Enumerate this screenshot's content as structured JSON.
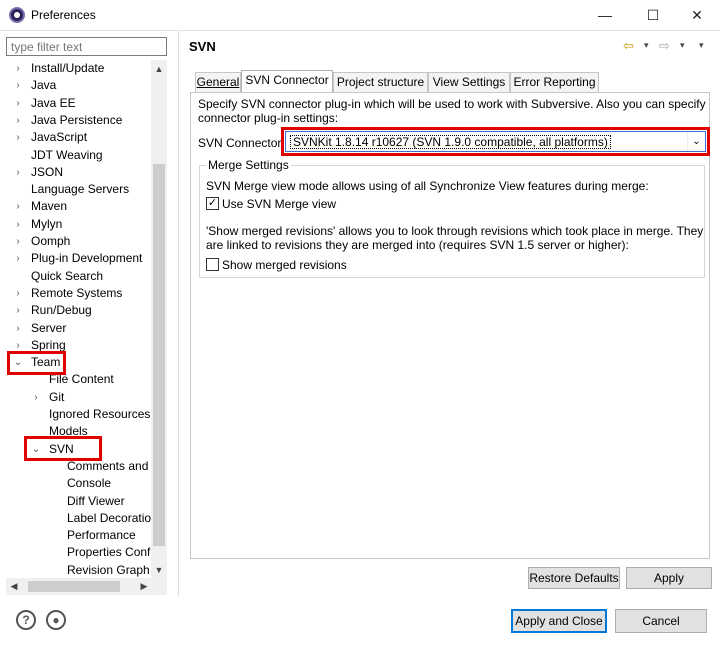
{
  "window": {
    "title": "Preferences",
    "minimize": "—",
    "maximize": "☐",
    "close": "✕"
  },
  "filter": {
    "placeholder": "type filter text"
  },
  "tree": {
    "items": [
      {
        "label": "Install/Update",
        "arrow": "›"
      },
      {
        "label": "Java",
        "arrow": "›"
      },
      {
        "label": "Java EE",
        "arrow": "›"
      },
      {
        "label": "Java Persistence",
        "arrow": "›"
      },
      {
        "label": "JavaScript",
        "arrow": "›"
      },
      {
        "label": "JDT Weaving",
        "arrow": ""
      },
      {
        "label": "JSON",
        "arrow": "›"
      },
      {
        "label": "Language Servers",
        "arrow": ""
      },
      {
        "label": "Maven",
        "arrow": "›"
      },
      {
        "label": "Mylyn",
        "arrow": "›"
      },
      {
        "label": "Oomph",
        "arrow": "›"
      },
      {
        "label": "Plug-in Development",
        "arrow": "›"
      },
      {
        "label": "Quick Search",
        "arrow": ""
      },
      {
        "label": "Remote Systems",
        "arrow": "›"
      },
      {
        "label": "Run/Debug",
        "arrow": "›"
      },
      {
        "label": "Server",
        "arrow": "›"
      },
      {
        "label": "Spring",
        "arrow": "›"
      },
      {
        "label": "Team",
        "arrow": "⌄"
      },
      {
        "label": "File Content",
        "arrow": ""
      },
      {
        "label": "Git",
        "arrow": "›"
      },
      {
        "label": "Ignored Resources",
        "arrow": ""
      },
      {
        "label": "Models",
        "arrow": ""
      },
      {
        "label": "SVN",
        "arrow": "⌄"
      },
      {
        "label": "Comments and",
        "arrow": ""
      },
      {
        "label": "Console",
        "arrow": ""
      },
      {
        "label": "Diff Viewer",
        "arrow": ""
      },
      {
        "label": "Label Decoration",
        "arrow": ""
      },
      {
        "label": "Performance",
        "arrow": ""
      },
      {
        "label": "Properties Confi",
        "arrow": ""
      },
      {
        "label": "Revision Graph",
        "arrow": ""
      }
    ]
  },
  "page": {
    "title": "SVN",
    "tabs": [
      "General",
      "SVN Connector",
      "Project structure",
      "View Settings",
      "Error Reporting"
    ],
    "description_line1": "Specify SVN connector plug-in which will be used to work with Subversive. Also you can specify",
    "description_line2": "connector plug-in settings:",
    "connector_label": "SVN Connector:",
    "connector_value": "SVNKit 1.8.14 r10627 (SVN 1.9.0 compatible, all platforms)",
    "merge_group": "Merge Settings",
    "merge_desc": "SVN Merge view mode allows using of all Synchronize View features during merge:",
    "use_merge_view": "Use SVN Merge view",
    "use_merge_view_checked": true,
    "show_desc_line1": "'Show merged revisions' allows you to look through revisions which took place in merge. They",
    "show_desc_line2": "are linked to revisions they are merged into (requires SVN 1.5 server or higher):",
    "show_merged": "Show merged revisions",
    "show_merged_checked": false
  },
  "buttons": {
    "restore_defaults": "Restore Defaults",
    "apply": "Apply",
    "apply_and_close": "Apply and Close",
    "cancel": "Cancel"
  },
  "icons": {
    "help": "?",
    "back": "⇦",
    "forward": "⇨",
    "dropdown": "▾"
  }
}
